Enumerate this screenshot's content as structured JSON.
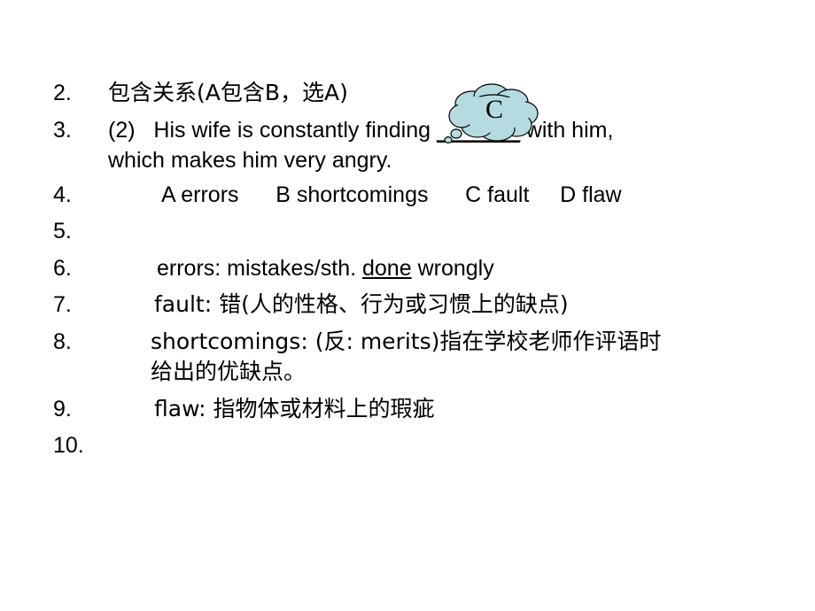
{
  "slide": {
    "background_color": "#ffffff",
    "text_color": "#000000"
  },
  "outline": {
    "items": [
      {
        "number": "2.",
        "text": "包含关系(A包含B，选A)"
      },
      {
        "number": "3.",
        "text": "(2)   His wife is constantly finding ",
        "blank": "_______",
        "text_after": " with him,",
        "wrap": "which makes him very angry."
      },
      {
        "number": "4.",
        "text": "A errors      B shortcomings      C fault     D flaw"
      },
      {
        "number": "5.",
        "text": ""
      },
      {
        "number": "6.",
        "text_before": "errors: mistakes/sth. ",
        "underlined": "done",
        "text_after": " wrongly"
      },
      {
        "number": "7.",
        "text": "fault: 错(人的性格、行为或习惯上的缺点)"
      },
      {
        "number": "8.",
        "text": "shortcomings: (反: merits)指在学校老师作评语时",
        "wrap": "给出的优缺点。"
      },
      {
        "number": "9.",
        "text": "flaw: 指物体或材料上的瑕疵"
      },
      {
        "number": "10.",
        "text": ""
      }
    ]
  },
  "callout": {
    "label": "C",
    "fill_color": "#b5dbe0",
    "stroke_color": "#000000",
    "shape": "thought-cloud"
  }
}
